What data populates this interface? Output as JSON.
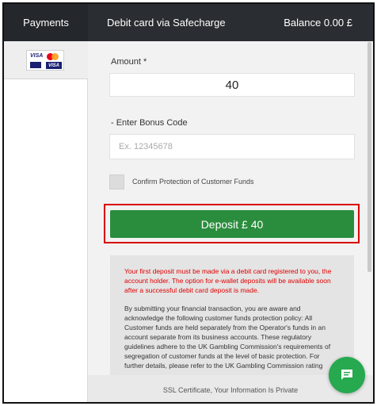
{
  "header": {
    "section_label": "Payments",
    "title": "Debit card via Safecharge",
    "balance": "Balance 0.00 £"
  },
  "sidebar": {
    "methods": [
      {
        "icon": "visa-mastercard-logo-icon",
        "selected": true
      }
    ]
  },
  "form": {
    "amount_label": "Amount *",
    "amount_value": "40",
    "bonus_label": "- Enter Bonus Code",
    "bonus_placeholder": "Ex. 12345678",
    "confirm_label": "Confirm Protection of Customer Funds",
    "deposit_button": "Deposit £ 40"
  },
  "info": {
    "warning": "Your first deposit must be made via a debit card registered to you, the account holder. The option for e-wallet deposits will be available soon after a successful debit card deposit is made.",
    "policy": "By submitting your financial transaction, you are aware and acknowledge the following customer funds protection policy: All Customer funds are held separately from the Operator's funds in an account separate from its business accounts. These regulatory guidelines adhere to the UK Gambling Commission's requirements of segregation of customer funds at the level of basic protection. For further details, please refer to the UK Gambling Commission rating"
  },
  "footer": {
    "text": "SSL Certificate, Your Information Is Private"
  },
  "colors": {
    "header_bg": "#2a2d31",
    "deposit_green": "#2a8d3d",
    "highlight_red": "#d90000",
    "warning_red": "#e00000",
    "chat_green": "#26a94f"
  }
}
